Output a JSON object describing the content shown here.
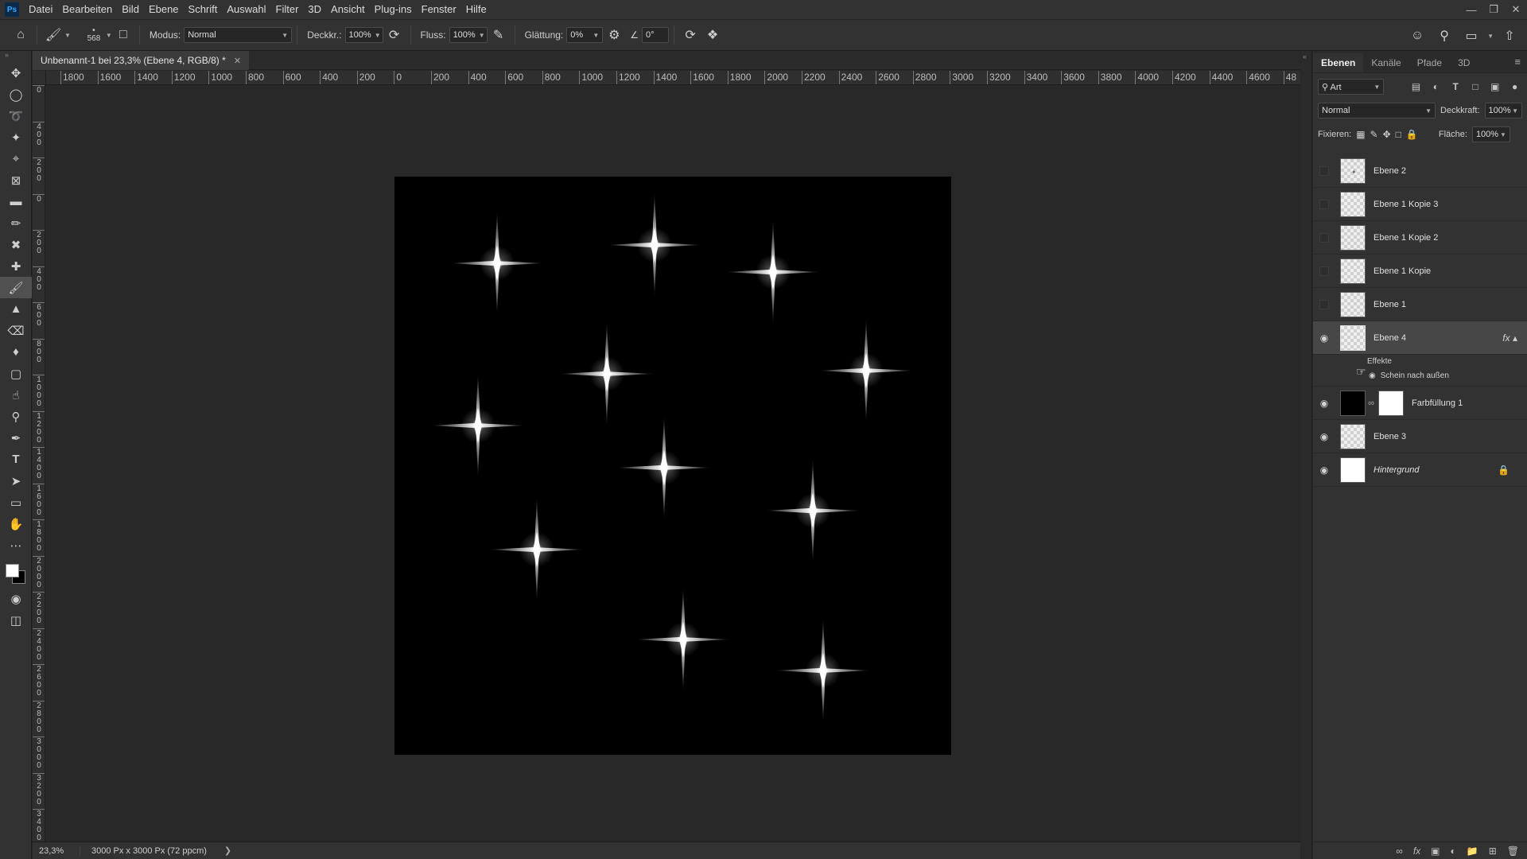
{
  "app": {
    "logo": "Ps",
    "menu": [
      "Datei",
      "Bearbeiten",
      "Bild",
      "Ebene",
      "Schrift",
      "Auswahl",
      "Filter",
      "3D",
      "Ansicht",
      "Plug-ins",
      "Fenster",
      "Hilfe"
    ]
  },
  "options": {
    "brush_size": "568",
    "modus_label": "Modus:",
    "modus_value": "Normal",
    "deckkraft_label": "Deckkr.:",
    "deckkraft_value": "100%",
    "fluss_label": "Fluss:",
    "fluss_value": "100%",
    "glaettung_label": "Glättung:",
    "glaettung_value": "0%",
    "angle_value": "0°"
  },
  "document": {
    "tab_title": "Unbenannt-1 bei 23,3% (Ebene 4, RGB/8) *",
    "zoom": "23,3%",
    "info": "3000 Px x 3000 Px (72 ppcm)"
  },
  "rulers": {
    "horizontal": [
      "1800",
      "1600",
      "1400",
      "1200",
      "1000",
      "800",
      "600",
      "400",
      "200",
      "0",
      "200",
      "400",
      "600",
      "800",
      "1000",
      "1200",
      "1400",
      "1600",
      "1800",
      "2000",
      "2200",
      "2400",
      "2600",
      "2800",
      "3000",
      "3200",
      "3400",
      "3600",
      "3800",
      "4000",
      "4200",
      "4400",
      "4600",
      "48"
    ],
    "vertical": [
      "0",
      "400",
      "200",
      "0",
      "200",
      "400",
      "600",
      "800",
      "1000",
      "1200",
      "1400",
      "1600",
      "1800",
      "2000",
      "2200",
      "2400",
      "2600",
      "2800",
      "3000",
      "3200",
      "3400",
      "3"
    ]
  },
  "layers_panel": {
    "tabs": [
      "Ebenen",
      "Kanäle",
      "Pfade",
      "3D"
    ],
    "filter_kind": "Art",
    "blend_mode": "Normal",
    "opacity_label": "Deckkraft:",
    "opacity_value": "100%",
    "lock_label": "Fixieren:",
    "fill_label": "Fläche:",
    "fill_value": "100%",
    "layers": [
      {
        "name": "Ebene 2",
        "visible": false
      },
      {
        "name": "Ebene 1 Kopie 3",
        "visible": false
      },
      {
        "name": "Ebene 1 Kopie 2",
        "visible": false
      },
      {
        "name": "Ebene 1 Kopie",
        "visible": false
      },
      {
        "name": "Ebene 1",
        "visible": false
      },
      {
        "name": "Ebene 4",
        "visible": true,
        "selected": true
      },
      {
        "name": "Farbfüllung 1",
        "visible": true
      },
      {
        "name": "Ebene 3",
        "visible": true
      },
      {
        "name": "Hintergrund",
        "visible": true,
        "locked": true
      }
    ],
    "effects_label": "Effekte",
    "effect_name": "Schein nach außen"
  },
  "canvas": {
    "background": "#000000",
    "sparkle_color": "#ffffff",
    "sparkle_count": 12
  }
}
